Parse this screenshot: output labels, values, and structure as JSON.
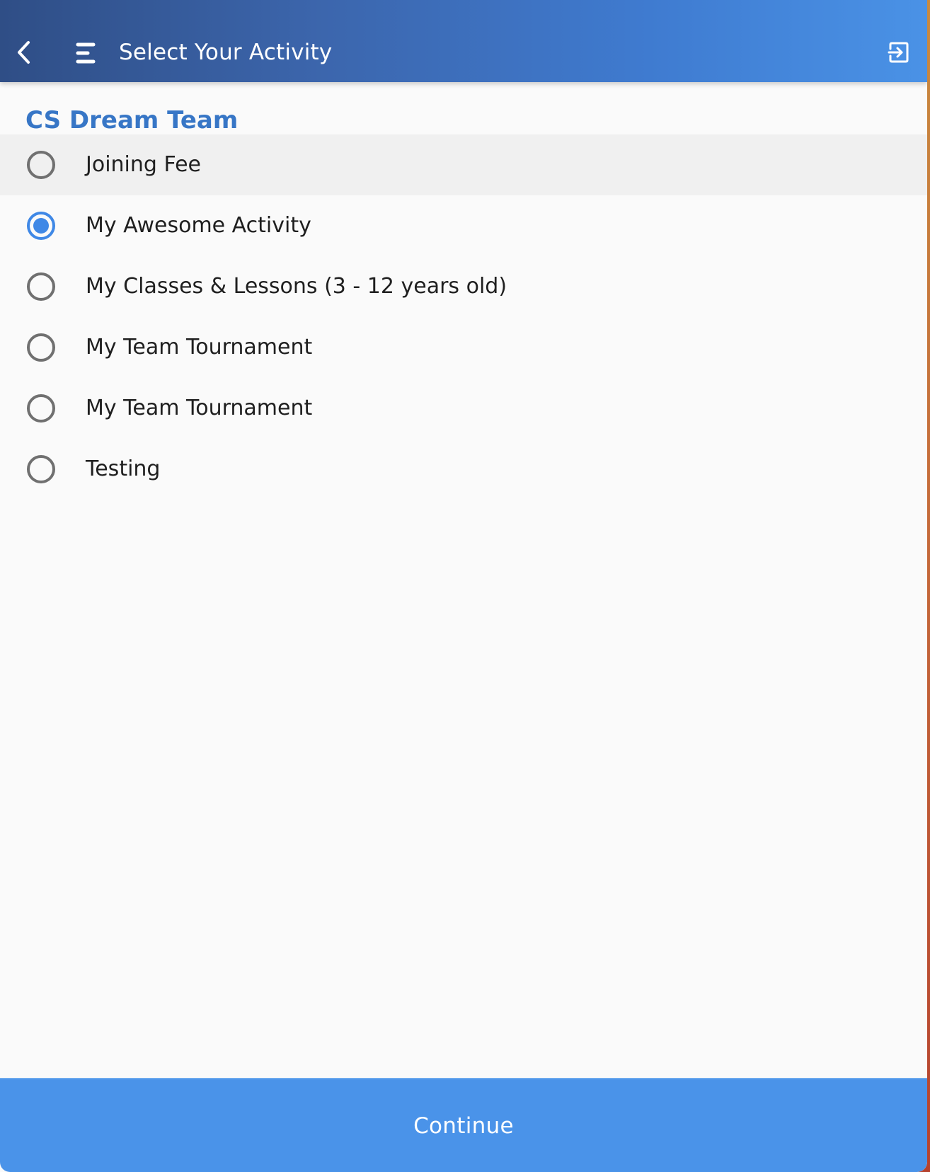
{
  "header": {
    "title": "Select Your Activity",
    "back_icon": "chevron-left-icon",
    "menu_icon": "menu-icon",
    "exit_icon": "exit-icon",
    "gradient_start": "#2f4e86",
    "gradient_end": "#4a92e6"
  },
  "organization": {
    "name": "CS Dream Team",
    "color": "#3776c6"
  },
  "activities": [
    {
      "label": "Joining Fee",
      "selected": false,
      "highlighted": true
    },
    {
      "label": "My Awesome Activity",
      "selected": true,
      "highlighted": false
    },
    {
      "label": "My Classes & Lessons (3 - 12 years old)",
      "selected": false,
      "highlighted": false
    },
    {
      "label": "My Team Tournament",
      "selected": false,
      "highlighted": false
    },
    {
      "label": "My Team Tournament",
      "selected": false,
      "highlighted": false
    },
    {
      "label": "Testing",
      "selected": false,
      "highlighted": false
    }
  ],
  "footer": {
    "continue_label": "Continue",
    "button_color": "#4a93e9"
  },
  "accent_color": "#3f88e6"
}
